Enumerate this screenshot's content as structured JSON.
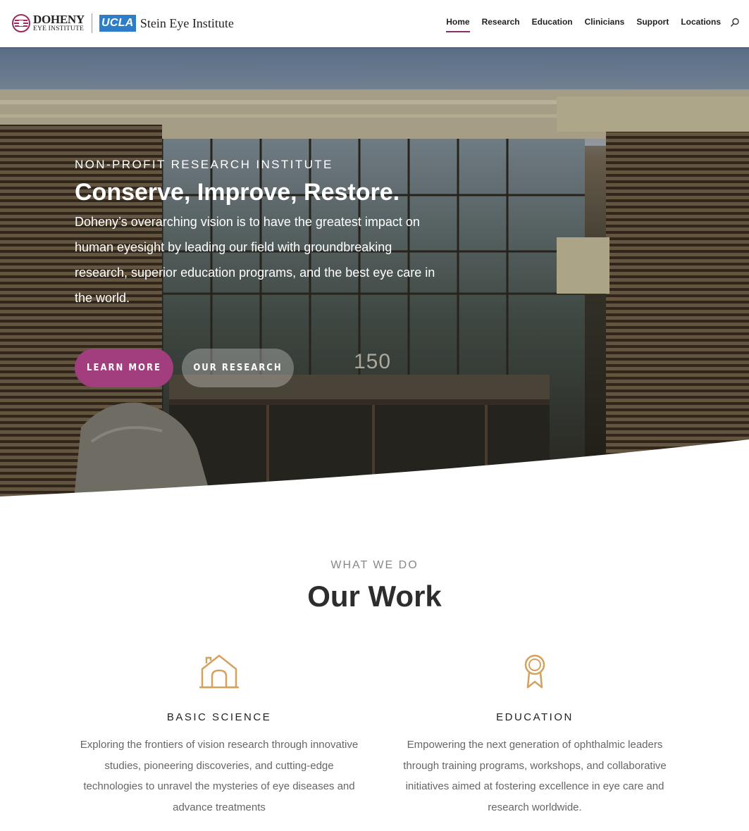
{
  "header": {
    "logo_doheny_line1": "DOHENY",
    "logo_doheny_line2": "EYE INSTITUTE",
    "logo_ucla": "UCLA",
    "logo_stein": "Stein Eye Institute",
    "nav": [
      {
        "label": "Home",
        "active": true
      },
      {
        "label": "Research"
      },
      {
        "label": "Education"
      },
      {
        "label": "Clinicians"
      },
      {
        "label": "Support"
      },
      {
        "label": "Locations"
      }
    ],
    "search_icon": "search-icon"
  },
  "hero": {
    "eyebrow": "NON-PROFIT RESEARCH INSTITUTE",
    "title": "Conserve, Improve, Restore.",
    "text": "Doheny’s overarching vision is to have the greatest impact on human eyesight by leading our field with groundbreaking research, superior education programs, and the best eye care in the world.",
    "primary_button": "LEARN MORE",
    "secondary_button": "OUR RESEARCH",
    "building_number": "150"
  },
  "work": {
    "eyebrow": "WHAT WE DO",
    "title": "Our Work",
    "cards": [
      {
        "icon": "house-icon",
        "title": "BASIC SCIENCE",
        "text": "Exploring the frontiers of vision research through innovative studies, pioneering discoveries, and cutting-edge technologies to unravel the mysteries of eye diseases and advance treatments"
      },
      {
        "icon": "award-ribbon-icon",
        "title": "EDUCATION",
        "text": "Empowering the next generation of ophthalmic leaders through training programs, workshops, and collaborative initiatives aimed at fostering excellence in eye care and research worldwide."
      }
    ]
  },
  "colors": {
    "accent": "#a23d7e",
    "nav_active_underline": "#8c2d6b",
    "ucla_blue": "#2d7dc8",
    "icon_gold": "#d4a15e"
  }
}
